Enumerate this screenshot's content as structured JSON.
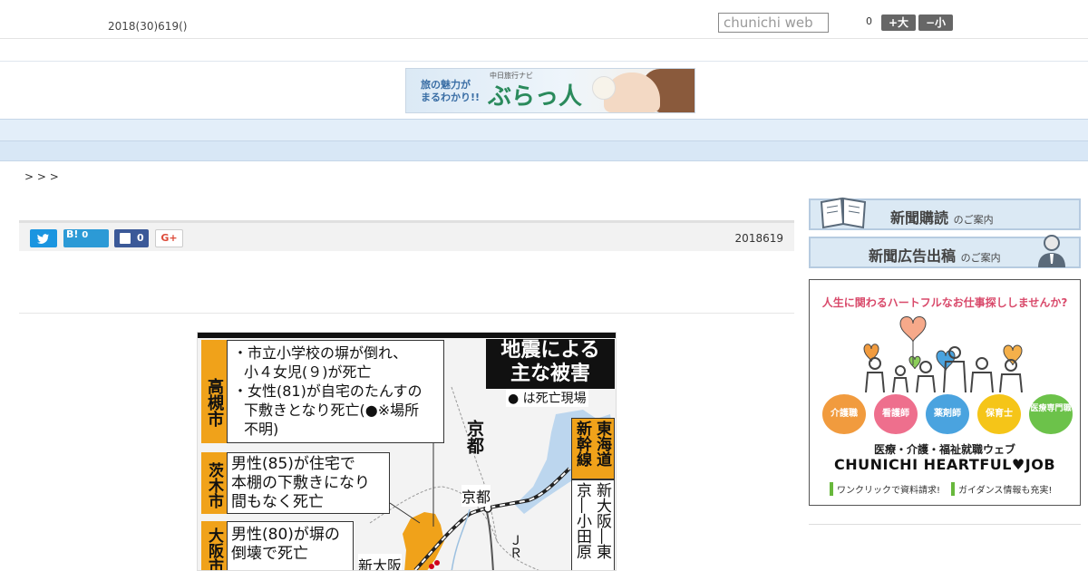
{
  "header": {
    "date": "2018(30)619()",
    "search_placeholder": "chunichi web",
    "count": "0",
    "font_larger": "+大",
    "font_smaller": "−小"
  },
  "banner": {
    "tagline_line1": "旅の魅力が",
    "tagline_line2": "まるわかり!!",
    "small_label": "中日旅行ナビ",
    "logo_text": "ぶらっ人"
  },
  "nav": {
    "items": [
      "",
      "",
      "",
      "",
      "",
      "",
      "",
      "",
      ""
    ]
  },
  "breadcrumb": "> > >",
  "share": {
    "hatena_label": "B!",
    "hatena_count": "0",
    "facebook_count": "0",
    "gplus_label": "G+",
    "article_date": "2018619"
  },
  "map": {
    "title_line1": "地震による",
    "title_line2": "主な被害",
    "legend": "● は死亡現場",
    "takatsuki_label": "高槻市",
    "takatsuki_text1": "・市立小学校の塀が倒れ、",
    "takatsuki_text2": "小４女児(９)が死亡",
    "takatsuki_text3": "・女性(81)が自宅のたんすの",
    "takatsuki_text4": "下敷きとなり死亡(●※場所",
    "takatsuki_text5": "不明)",
    "ibaraki_label": "茨木市",
    "ibaraki_text1": "男性(85)が住宅で",
    "ibaraki_text2": "本棚の下敷きになり",
    "ibaraki_text3": "間もなく死亡",
    "osaka_label": "大阪市",
    "osaka_text1": "男性(80)が塀の",
    "osaka_text2": "倒壊で死亡",
    "kyoto_pref": "京都",
    "kyoto_city": "京都",
    "shin_osaka": "新大阪",
    "jr": "ＪＲ",
    "shinkansen_label": "東海道新幹線",
    "shinkansen_text": "新大阪―東京―小田原が一"
  },
  "sidebar": {
    "subscribe_main": "新聞購読",
    "subscribe_small": "のご案内",
    "ads_main": "新聞広告出稿",
    "ads_small": "のご案内",
    "ad_heading": "人生に関わるハートフルなお仕事探ししませんか?",
    "circles": [
      {
        "label": "介護職",
        "color": "#f19b3e"
      },
      {
        "label": "看護師",
        "color": "#ee6f8d"
      },
      {
        "label": "薬剤師",
        "color": "#4aa3df"
      },
      {
        "label": "保育士",
        "color": "#f5c518"
      },
      {
        "label": "医療専門職",
        "color": "#6cc24a"
      }
    ],
    "ad_sub": "医療・介護・福祉就職ウェブ",
    "ad_brand": "CHUNICHI HEARTFUL♥JOB",
    "ad_bullet1": "ワンクリックで資料請求!",
    "ad_bullet2": "ガイダンス情報も充実!"
  }
}
